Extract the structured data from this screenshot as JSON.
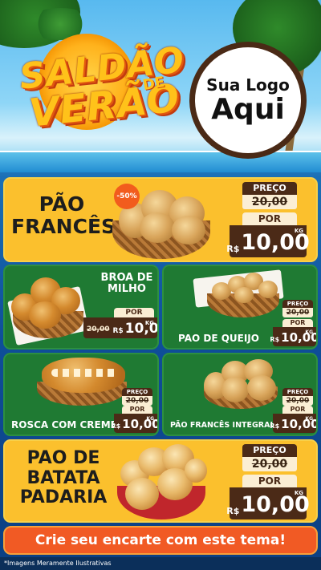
{
  "header": {
    "title_line1": "SALDÃO",
    "title_line2": "VERÃO",
    "title_de": "DE",
    "logo_line1": "Sua Logo",
    "logo_line2": "Aqui"
  },
  "labels": {
    "preco": "PREÇO",
    "por": "POR",
    "currency": "R$",
    "unit": "KG"
  },
  "products": [
    {
      "name_lines": [
        "PÃO",
        "FRANCÊS"
      ],
      "badge": "-50%",
      "old_price": "20,00",
      "new_price": "10,00"
    },
    {
      "name_lines": [
        "BROA DE",
        "MILHO"
      ],
      "old_price": "20,00",
      "new_price": "10,00"
    },
    {
      "name": "PAO DE QUEIJO",
      "old_price": "20,00",
      "new_price": "10,00"
    },
    {
      "name": "ROSCA COM CREME",
      "old_price": "20,00",
      "new_price": "10,00"
    },
    {
      "name": "PÃO FRANCÊS INTEGRAL",
      "old_price": "20,00",
      "new_price": "10,00"
    },
    {
      "name_lines": [
        "PAO DE",
        "BATATA",
        "PADARIA"
      ],
      "old_price": "20,00",
      "new_price": "10,00"
    }
  ],
  "cta": "Crie seu encarte com este tema!",
  "footer": "*Imagens Meramente Ilustrativas"
}
